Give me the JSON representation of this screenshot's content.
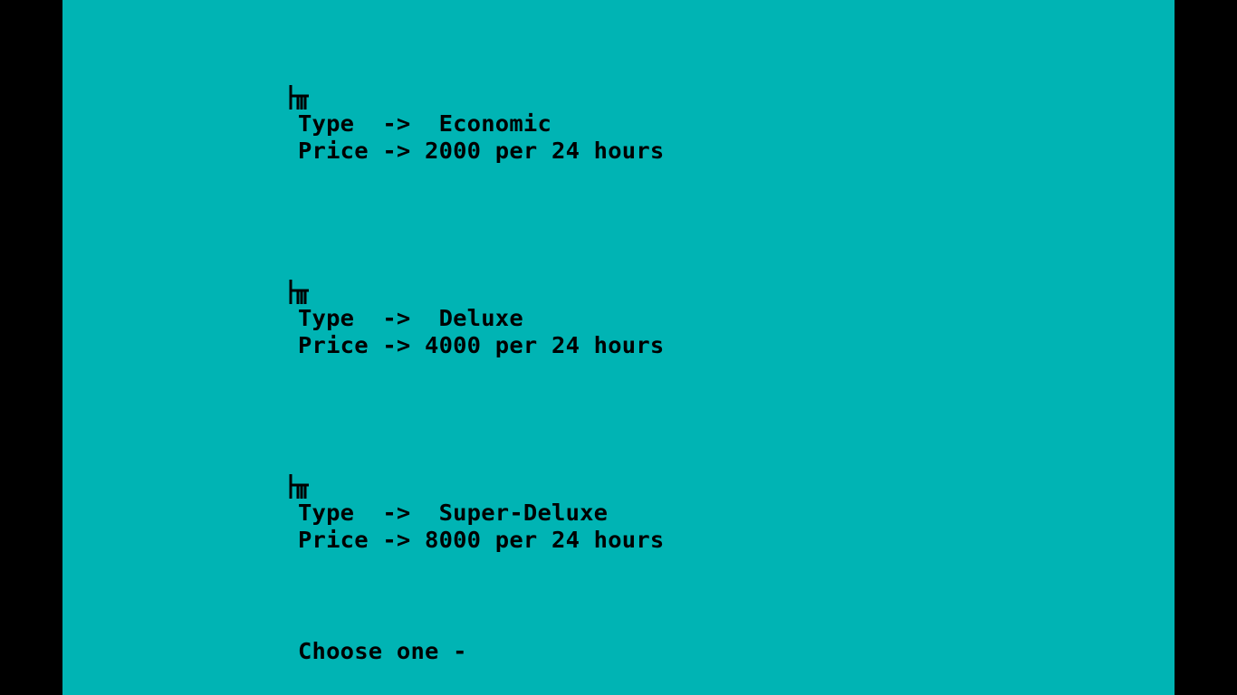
{
  "palette": {
    "background": "#00b4b4",
    "letterbox": "#000000",
    "text": "#000000"
  },
  "room_glyph_icon": "room-glyph-icon",
  "rooms": [
    {
      "type_line": "Type  ->  Economic",
      "price_line": "Price -> 2000 per 24 hours"
    },
    {
      "type_line": "Type  ->  Deluxe",
      "price_line": "Price -> 4000 per 24 hours"
    },
    {
      "type_line": "Type  ->  Super-Deluxe",
      "price_line": "Price -> 8000 per 24 hours"
    }
  ],
  "prompt": "Choose one -"
}
